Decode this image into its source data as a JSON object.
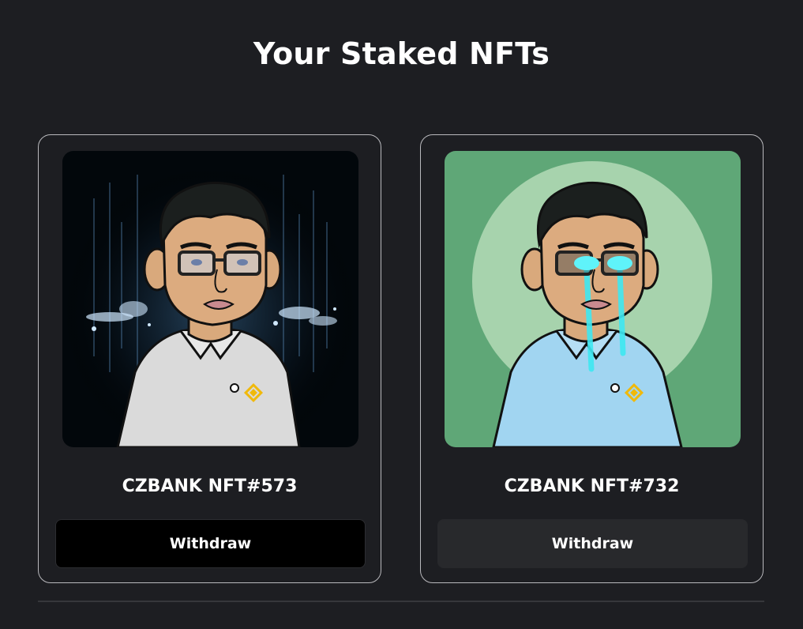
{
  "page": {
    "title": "Your Staked NFTs"
  },
  "nfts": [
    {
      "name": "CZBANK NFT#573",
      "withdraw_label": "Withdraw",
      "background": "dark-sparkle",
      "shirt_color": "#d9d9d9"
    },
    {
      "name": "CZBANK NFT#732",
      "withdraw_label": "Withdraw",
      "background": "green-circle",
      "shirt_color": "#9fd4ef"
    }
  ],
  "colors": {
    "page_background": "#1d1e22",
    "card_border": "#b9b9bd",
    "button_dark": "#000000",
    "button_grey": "#28292c",
    "binance_yellow": "#f0b90b",
    "laser_cyan": "#3ee8f2"
  }
}
